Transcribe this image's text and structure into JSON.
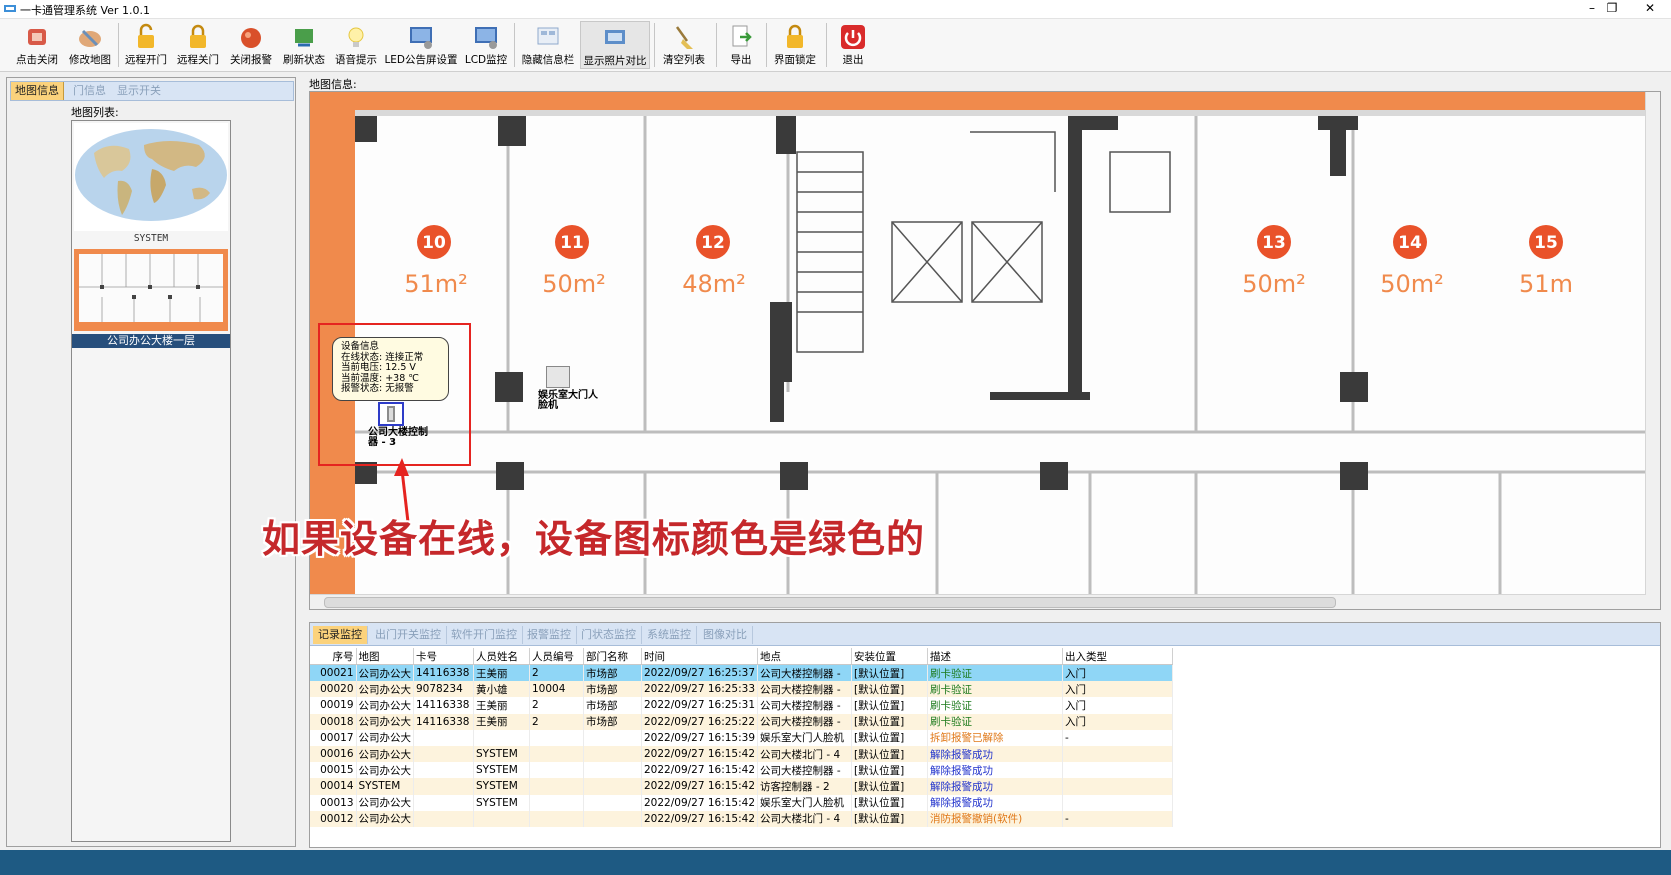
{
  "window": {
    "title": "一卡通管理系统 Ver 1.0.1",
    "minimize": "–",
    "restore": "❐",
    "close": "✕"
  },
  "toolbar": {
    "items": [
      {
        "label": "点击关闭",
        "icon": "door-close-icon"
      },
      {
        "label": "修改地图",
        "icon": "edit-map-icon"
      },
      {
        "label": "远程开门",
        "icon": "unlock-icon"
      },
      {
        "label": "远程关门",
        "icon": "lock-icon"
      },
      {
        "label": "关闭报警",
        "icon": "alarm-off-icon"
      },
      {
        "label": "刷新状态",
        "icon": "refresh-icon"
      },
      {
        "label": "语音提示",
        "icon": "bulb-icon"
      },
      {
        "label": "LED公告屏设置",
        "icon": "led-monitor-icon"
      },
      {
        "label": "LCD监控",
        "icon": "lcd-monitor-icon"
      },
      {
        "label": "隐藏信息栏",
        "icon": "hide-panel-icon"
      },
      {
        "label": "显示照片对比",
        "icon": "photo-compare-icon"
      },
      {
        "label": "清空列表",
        "icon": "broom-icon"
      },
      {
        "label": "导出",
        "icon": "export-icon"
      },
      {
        "label": "界面锁定",
        "icon": "ui-lock-icon"
      },
      {
        "label": "退出",
        "icon": "power-icon"
      }
    ]
  },
  "left_panel": {
    "tabs": [
      "地图信息",
      "门信息",
      "显示开关"
    ],
    "map_list_label": "地图列表:",
    "maps": [
      {
        "name": "SYSTEM"
      },
      {
        "name": "公司办公大楼一层"
      }
    ]
  },
  "map_view": {
    "label": "地图信息:",
    "rooms": [
      {
        "number": "10",
        "area": "51m²"
      },
      {
        "number": "11",
        "area": "50m²"
      },
      {
        "number": "12",
        "area": "48m²"
      },
      {
        "number": "13",
        "area": "50m²"
      },
      {
        "number": "14",
        "area": "50m²"
      },
      {
        "number": "15",
        "area": "51m"
      }
    ],
    "device_info": {
      "heading": "设备信息",
      "online": "在线状态: 连接正常",
      "voltage": "当前电压: 12.5 V",
      "temperature": "当前温度: +38 ℃",
      "alarm": "报警状态: 无报警"
    },
    "device1_label": "公司大楼控制器 - 3",
    "device2_label": "娱乐室大门人脸机",
    "caption": "如果设备在线，设备图标颜色是绿色的",
    "colors": {
      "map_border": "#f08a4c",
      "highlight_box": "#e52420",
      "caption": "#c5282b"
    }
  },
  "monitor": {
    "tabs": [
      "记录监控",
      "出门开关监控",
      "软件开门监控",
      "报警监控",
      "门状态监控",
      "系统监控",
      "图像对比"
    ],
    "columns": [
      "序号",
      "地图",
      "卡号",
      "人员姓名",
      "人员编号",
      "部门名称",
      "时间",
      "地点",
      "安装位置",
      "描述",
      "出入类型"
    ],
    "rows": [
      {
        "no": "00021",
        "map": "公司办公大",
        "card": "14116338",
        "name": "王美丽",
        "pid": "2",
        "dept": "市场部",
        "time": "2022/09/27 16:25:37",
        "place": "公司大楼控制器 -",
        "install": "[默认位置]",
        "desc": "刷卡验证",
        "desc_color": "green",
        "type": "入门"
      },
      {
        "no": "00020",
        "map": "公司办公大",
        "card": "9078234",
        "name": "黄小雄",
        "pid": "10004",
        "dept": "市场部",
        "time": "2022/09/27 16:25:33",
        "place": "公司大楼控制器 -",
        "install": "[默认位置]",
        "desc": "刷卡验证",
        "desc_color": "green",
        "type": "入门"
      },
      {
        "no": "00019",
        "map": "公司办公大",
        "card": "14116338",
        "name": "王美丽",
        "pid": "2",
        "dept": "市场部",
        "time": "2022/09/27 16:25:31",
        "place": "公司大楼控制器 -",
        "install": "[默认位置]",
        "desc": "刷卡验证",
        "desc_color": "green",
        "type": "入门"
      },
      {
        "no": "00018",
        "map": "公司办公大",
        "card": "14116338",
        "name": "王美丽",
        "pid": "2",
        "dept": "市场部",
        "time": "2022/09/27 16:25:22",
        "place": "公司大楼控制器 -",
        "install": "[默认位置]",
        "desc": "刷卡验证",
        "desc_color": "green",
        "type": "入门"
      },
      {
        "no": "00017",
        "map": "公司办公大",
        "card": "",
        "name": "",
        "pid": "",
        "dept": "",
        "time": "2022/09/27 16:15:39",
        "place": "娱乐室大门人脸机",
        "install": "[默认位置]",
        "desc": "拆卸报警已解除",
        "desc_color": "orange",
        "type": "-"
      },
      {
        "no": "00016",
        "map": "公司办公大",
        "card": "",
        "name": "SYSTEM",
        "pid": "",
        "dept": "",
        "time": "2022/09/27 16:15:42",
        "place": "公司大楼北门 - 4",
        "install": "[默认位置]",
        "desc": "解除报警成功",
        "desc_color": "blue",
        "type": ""
      },
      {
        "no": "00015",
        "map": "公司办公大",
        "card": "",
        "name": "SYSTEM",
        "pid": "",
        "dept": "",
        "time": "2022/09/27 16:15:42",
        "place": "公司大楼控制器 -",
        "install": "[默认位置]",
        "desc": "解除报警成功",
        "desc_color": "blue",
        "type": ""
      },
      {
        "no": "00014",
        "map": "SYSTEM",
        "card": "",
        "name": "SYSTEM",
        "pid": "",
        "dept": "",
        "time": "2022/09/27 16:15:42",
        "place": "访客控制器 - 2",
        "install": "[默认位置]",
        "desc": "解除报警成功",
        "desc_color": "blue",
        "type": ""
      },
      {
        "no": "00013",
        "map": "公司办公大",
        "card": "",
        "name": "SYSTEM",
        "pid": "",
        "dept": "",
        "time": "2022/09/27 16:15:42",
        "place": "娱乐室大门人脸机",
        "install": "[默认位置]",
        "desc": "解除报警成功",
        "desc_color": "blue",
        "type": ""
      },
      {
        "no": "00012",
        "map": "公司办公大",
        "card": "",
        "name": "",
        "pid": "",
        "dept": "",
        "time": "2022/09/27 16:15:42",
        "place": "公司大楼北门 - 4",
        "install": "[默认位置]",
        "desc": "消防报警撤销(软件)",
        "desc_color": "orange",
        "type": "-"
      }
    ]
  }
}
